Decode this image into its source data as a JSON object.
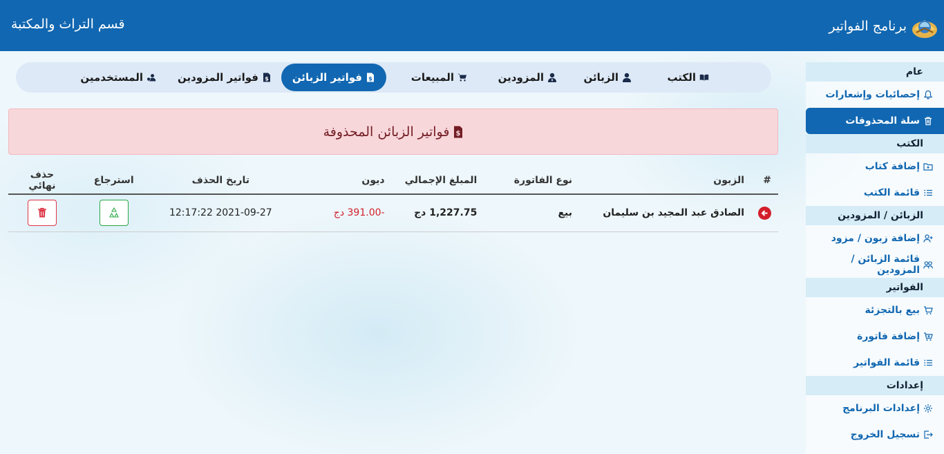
{
  "header": {
    "app_title": "برنامج الفواتير",
    "department": "قسم التراث والمكتبة"
  },
  "sidebar": {
    "sections": [
      {
        "title": "عام",
        "items": [
          {
            "label": "إحصائيات وإشعارات",
            "icon": "bell-icon"
          },
          {
            "label": "سلة المحذوفات",
            "icon": "trash-icon",
            "active": true
          }
        ]
      },
      {
        "title": "الكتب",
        "items": [
          {
            "label": "إضافة كتاب",
            "icon": "folder-plus-icon"
          },
          {
            "label": "قائمة الكتب",
            "icon": "list-icon"
          }
        ]
      },
      {
        "title": "الزبائن / المزودين",
        "items": [
          {
            "label": "إضافة زبون / مزود",
            "icon": "user-plus-icon"
          },
          {
            "label": "قائمة الزبائن / المزودين",
            "icon": "users-icon"
          }
        ]
      },
      {
        "title": "الفواتير",
        "items": [
          {
            "label": "بيع بالتجزئة",
            "icon": "cart-icon"
          },
          {
            "label": "إضافة فاتورة",
            "icon": "cart-plus-icon"
          },
          {
            "label": "قائمة الفواتير",
            "icon": "list-icon"
          }
        ]
      },
      {
        "title": "إعدادات",
        "items": [
          {
            "label": "إعدادات البرنامج",
            "icon": "gear-icon"
          },
          {
            "label": "تسجيل الخروج",
            "icon": "logout-icon"
          }
        ]
      }
    ]
  },
  "tabs": [
    {
      "label": "الكتب",
      "icon": "book-icon"
    },
    {
      "label": "الزبائن",
      "icon": "user-icon"
    },
    {
      "label": "المزودين",
      "icon": "user-tie-icon"
    },
    {
      "label": "المبيعات",
      "icon": "cart-icon"
    },
    {
      "label": "فواتير الزبائن",
      "icon": "invoice-icon",
      "active": true
    },
    {
      "label": "فواتير المزودين",
      "icon": "invoice-icon"
    },
    {
      "label": "المستخدمين",
      "icon": "user-shield-icon"
    }
  ],
  "alert": {
    "title": "فواتير الزبائن المحذوفة",
    "icon": "invoice-icon"
  },
  "table": {
    "columns": [
      "#",
      "الزبون",
      "نوع الفاتورة",
      "المبلغ الإجمالي",
      "ديون",
      "تاريخ الحذف",
      "استرجاع",
      "حذف نهائي"
    ],
    "rows": [
      {
        "customer": "الصادق عبد المجيد بن سليمان",
        "type": "بيع",
        "total": "1,227.75 دج",
        "debt": "-391.00 دج",
        "deleted_at": "2021-09-27 12:17:22"
      }
    ]
  },
  "colors": {
    "primary": "#1167b1",
    "alert_bg": "#f8d7da",
    "danger": "#dc3545",
    "success": "#28a745"
  }
}
